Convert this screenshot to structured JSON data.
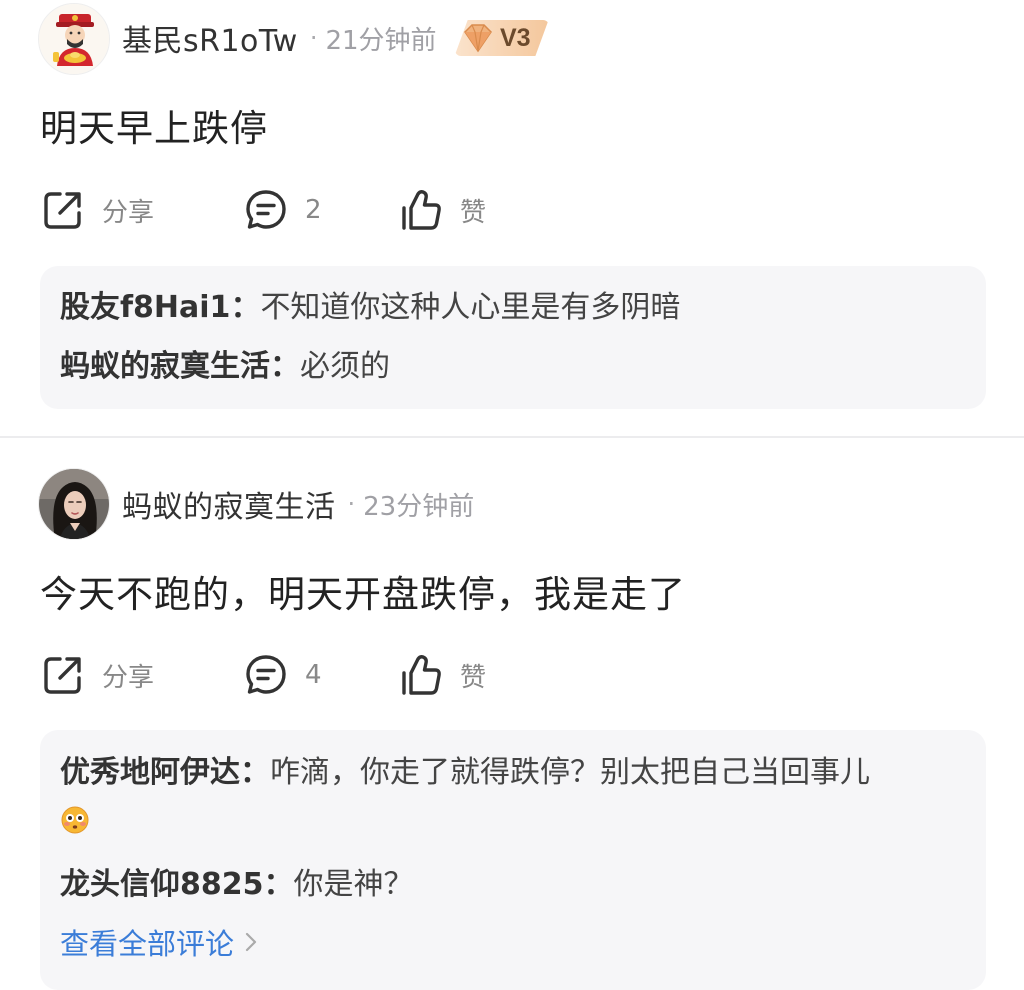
{
  "posts": [
    {
      "author": "基民sR1oTw",
      "time": "21分钟前",
      "badge": "V3",
      "content": "明天早上跌停",
      "actions": {
        "share_label": "分享",
        "comment_count": "2",
        "like_label": "赞"
      },
      "replies": [
        {
          "author": "股友f8Hai1",
          "text": "不知道你这种人心里是有多阴暗"
        },
        {
          "author": "蚂蚁的寂寞生活",
          "text": "必须的"
        }
      ]
    },
    {
      "author": "蚂蚁的寂寞生活",
      "time": "23分钟前",
      "content": "今天不跑的，明天开盘跌停，我是走了",
      "actions": {
        "share_label": "分享",
        "comment_count": "4",
        "like_label": "赞"
      },
      "replies": [
        {
          "author": "优秀地阿伊达",
          "text": "咋滴，你走了就得跌停？别太把自己当回事儿",
          "emoji": "flushed-face-emoji"
        },
        {
          "author": "龙头信仰8825",
          "text": "你是神？"
        }
      ],
      "view_all_label": "查看全部评论"
    }
  ],
  "separator": "·",
  "colon": "：",
  "colors": {
    "link": "#3b7dd8",
    "muted": "#888888",
    "reply_bg": "#f6f6f8",
    "badge_text": "#6b4a2c"
  },
  "icons": [
    "share-icon",
    "comment-icon",
    "like-icon",
    "chevron-right-icon",
    "gem-icon",
    "avatar-god-of-wealth",
    "avatar-woman-photo"
  ]
}
